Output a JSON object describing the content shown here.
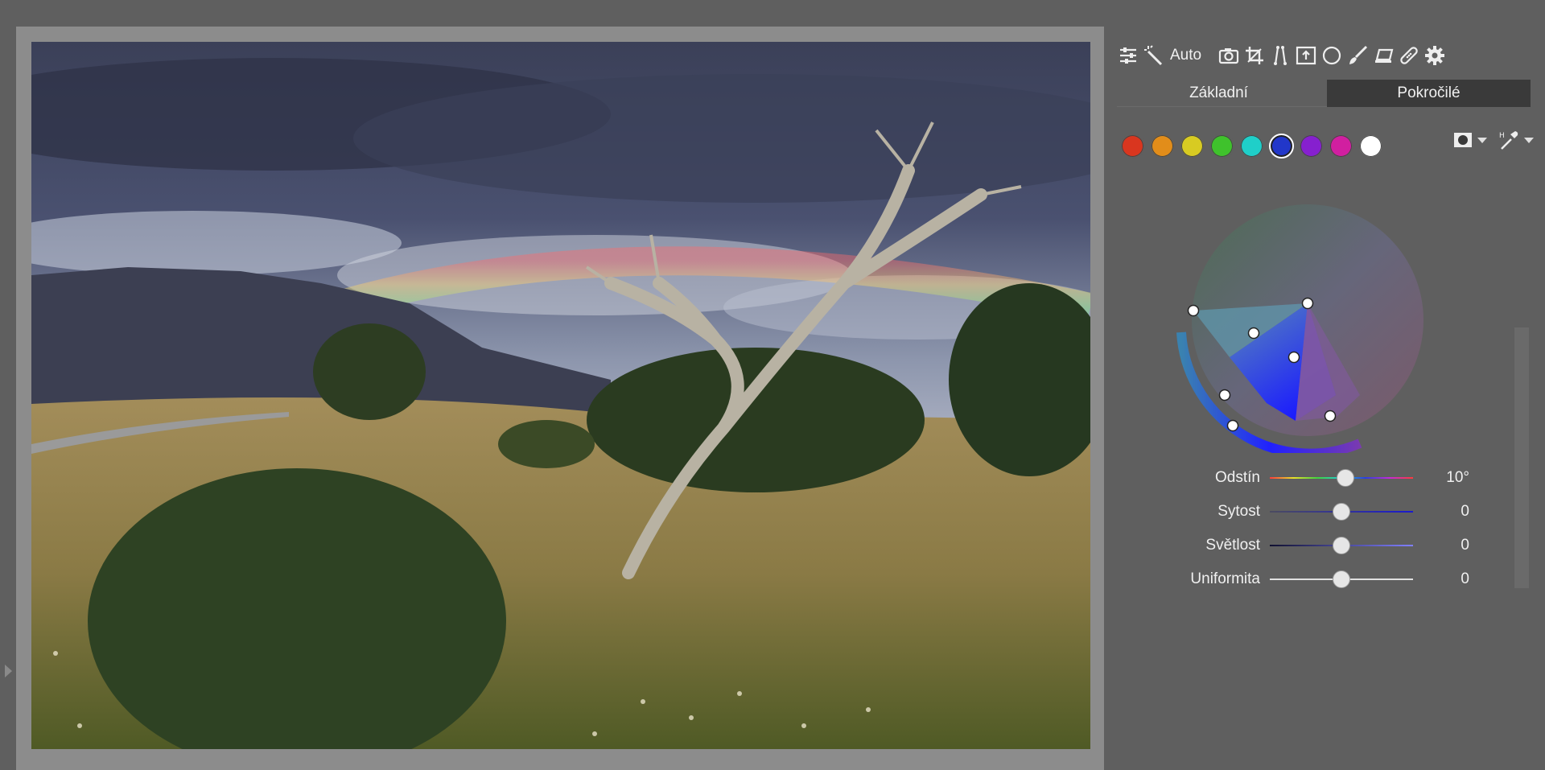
{
  "toolbar": {
    "auto_label": "Auto",
    "icons": [
      "sliders-icon",
      "magic-wand-icon",
      "camera-icon",
      "crop-icon",
      "perspective-icon",
      "export-icon",
      "circle-icon",
      "brush-icon",
      "eraser-icon",
      "bandage-icon",
      "gear-icon"
    ]
  },
  "tabs": [
    {
      "label": "Základní",
      "active": false
    },
    {
      "label": "Pokročilé",
      "active": true
    }
  ],
  "swatches": [
    {
      "name": "red",
      "color": "#d9361f"
    },
    {
      "name": "orange",
      "color": "#e28d1a"
    },
    {
      "name": "yellow",
      "color": "#d8cb22"
    },
    {
      "name": "green",
      "color": "#3fc22c"
    },
    {
      "name": "cyan",
      "color": "#1fcfc9"
    },
    {
      "name": "blue",
      "color": "#2237c9",
      "selected": true
    },
    {
      "name": "purple",
      "color": "#8620cf"
    },
    {
      "name": "magenta",
      "color": "#d11fa0"
    },
    {
      "name": "white",
      "color": "#ffffff"
    }
  ],
  "sliders": [
    {
      "key": "hue",
      "label": "Odstín",
      "value": "10°",
      "position": 0.53,
      "track": "linear-gradient(to right,#ff3b3b,#e8e22a,#3fd43f,#22c9d9,#2a3fe0,#c22ad9,#ff3b3b)"
    },
    {
      "key": "saturation",
      "label": "Sytost",
      "value": "0",
      "position": 0.5,
      "track": "linear-gradient(to right,#4b4b60,#1a1acf)"
    },
    {
      "key": "lightness",
      "label": "Světlost",
      "value": "0",
      "position": 0.5,
      "track": "linear-gradient(to right,#101030,#8080ff)"
    },
    {
      "key": "uniformity",
      "label": "Uniformita",
      "value": "0",
      "position": 0.5,
      "track": "linear-gradient(to right,#e0e0e0,#e0e0e0)"
    }
  ],
  "colors": {
    "panel_bg": "#5f5f5f",
    "frame": "#8c8c8c",
    "tab_active": "#3a3a3a"
  }
}
